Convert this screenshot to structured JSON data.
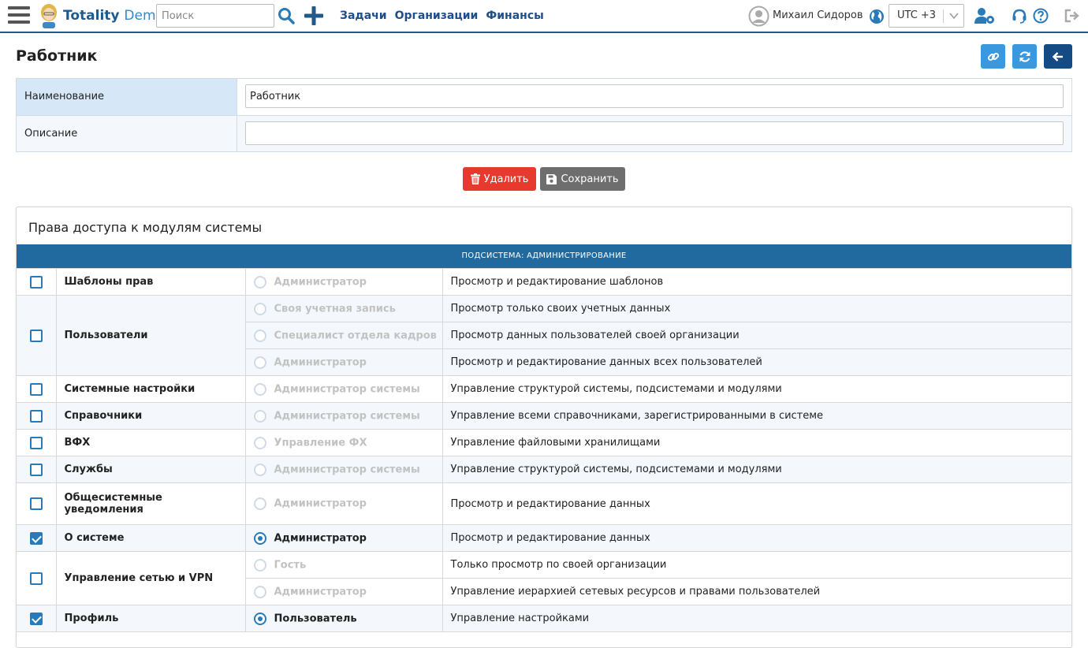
{
  "app": {
    "brand_primary": "Totality",
    "brand_secondary": "Demo",
    "accent_color": "#1f5a8a"
  },
  "header": {
    "search_placeholder": "Поиск",
    "nav": [
      "Задачи",
      "Организации",
      "Финансы"
    ],
    "user_name": "Михаил Сидоров",
    "timezone": "UTC +3"
  },
  "page": {
    "title": "Работник"
  },
  "form": {
    "name_label": "Наименование",
    "name_value": "Работник",
    "desc_label": "Описание",
    "desc_value": ""
  },
  "actions": {
    "delete_label": "Удалить",
    "save_label": "Сохранить",
    "delete_color": "#e8392e",
    "save_color": "#6e6e6e"
  },
  "rights": {
    "title": "Права доступа к модулям системы",
    "subsystem": "ПОДСИСТЕМА: АДМИНИСТРИРОВАНИЕ",
    "modules": [
      {
        "name": "Шаблоны прав",
        "checked": false,
        "roles": [
          {
            "label": "Администратор",
            "selected": false,
            "desc": "Просмотр и редактирование шаблонов"
          }
        ]
      },
      {
        "name": "Пользователи",
        "checked": false,
        "roles": [
          {
            "label": "Своя учетная запись",
            "selected": false,
            "desc": "Просмотр только своих учетных данных"
          },
          {
            "label": "Специалист отдела кадров",
            "selected": false,
            "desc": "Просмотр данных пользователей своей организации"
          },
          {
            "label": "Администратор",
            "selected": false,
            "desc": "Просмотр и редактирование данных всех пользователей"
          }
        ]
      },
      {
        "name": "Системные настройки",
        "checked": false,
        "roles": [
          {
            "label": "Администратор системы",
            "selected": false,
            "desc": "Управление структурой системы, подсистемами и модулями"
          }
        ]
      },
      {
        "name": "Справочники",
        "checked": false,
        "roles": [
          {
            "label": "Администратор системы",
            "selected": false,
            "desc": "Управление всеми справочниками, зарегистрированными в системе"
          }
        ]
      },
      {
        "name": "ВФХ",
        "checked": false,
        "roles": [
          {
            "label": "Управление ФХ",
            "selected": false,
            "desc": "Управление файловыми хранилищами"
          }
        ]
      },
      {
        "name": "Службы",
        "checked": false,
        "roles": [
          {
            "label": "Администратор системы",
            "selected": false,
            "desc": "Управление структурой системы, подсистемами и модулями"
          }
        ]
      },
      {
        "name": "Общесистемные уведомления",
        "checked": false,
        "roles": [
          {
            "label": "Администратор",
            "selected": false,
            "desc": "Просмотр и редактирование данных"
          }
        ]
      },
      {
        "name": "О системе",
        "checked": true,
        "roles": [
          {
            "label": "Администратор",
            "selected": true,
            "desc": "Просмотр и редактирование данных"
          }
        ]
      },
      {
        "name": "Управление сетью и VPN",
        "checked": false,
        "roles": [
          {
            "label": "Гость",
            "selected": false,
            "desc": "Только просмотр по своей организации"
          },
          {
            "label": "Администратор",
            "selected": false,
            "desc": "Управление иерархией сетевых ресурсов и правами пользователей"
          }
        ]
      },
      {
        "name": "Профиль",
        "checked": true,
        "roles": [
          {
            "label": "Пользователь",
            "selected": true,
            "desc": "Управление настройками"
          }
        ]
      }
    ]
  }
}
